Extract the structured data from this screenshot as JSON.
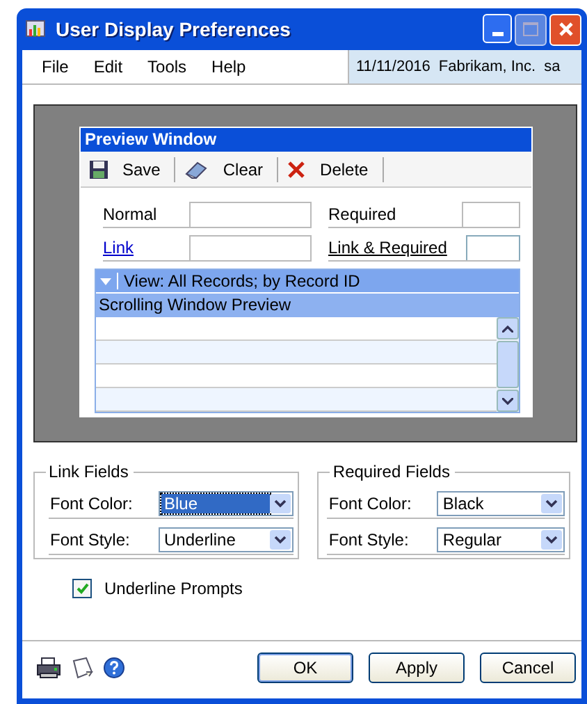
{
  "window": {
    "title": "User Display Preferences"
  },
  "menu": [
    {
      "label": "File"
    },
    {
      "label": "Edit"
    },
    {
      "label": "Tools"
    },
    {
      "label": "Help"
    }
  ],
  "status": {
    "date": "11/11/2016",
    "company": "Fabrikam, Inc.",
    "user": "sa"
  },
  "preview": {
    "title": "Preview Window",
    "toolbar": [
      {
        "label": "Save",
        "kind": "save"
      },
      {
        "label": "Clear",
        "kind": "clear"
      },
      {
        "label": "Delete",
        "kind": "delete"
      }
    ],
    "fields": [
      {
        "label": "Normal",
        "kind": "normal"
      },
      {
        "label": "Required",
        "kind": "required"
      },
      {
        "label": "Link",
        "kind": "link"
      },
      {
        "label": "Link & Required",
        "kind": "link_required"
      }
    ],
    "view_label": "View: All Records; by Record ID",
    "grid_title": "Scrolling Window Preview"
  },
  "groups": [
    {
      "title": "Link Fields",
      "rows": [
        {
          "label": "Font Color:",
          "value": "Blue",
          "focused": true
        },
        {
          "label": "Font Style:",
          "value": "Underline",
          "focused": false
        }
      ]
    },
    {
      "title": "Required Fields",
      "rows": [
        {
          "label": "Font Color:",
          "value": "Black",
          "focused": false
        },
        {
          "label": "Font Style:",
          "value": "Regular",
          "focused": false
        }
      ]
    }
  ],
  "checkbox": {
    "label": "Underline Prompts",
    "checked": true
  },
  "buttons": [
    {
      "label": "OK",
      "default": true
    },
    {
      "label": "Apply",
      "default": false
    },
    {
      "label": "Cancel",
      "default": false
    }
  ]
}
